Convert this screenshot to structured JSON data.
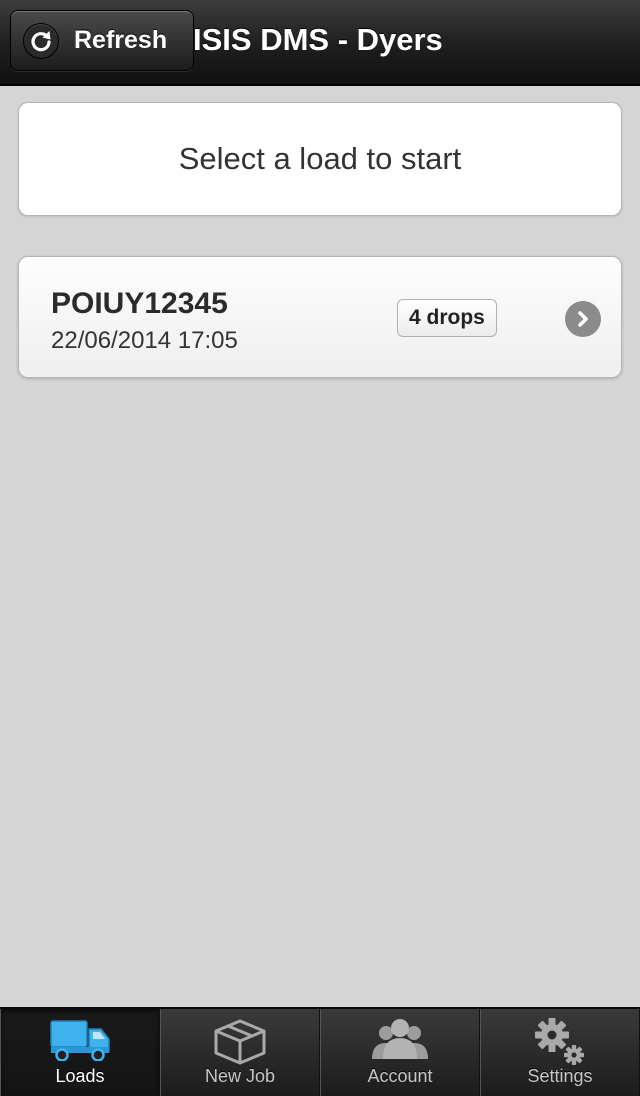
{
  "header": {
    "refresh_label": "Refresh",
    "title": "ISIS DMS - Dyers"
  },
  "prompt": {
    "text": "Select a load to start"
  },
  "loads": [
    {
      "id": "POIUY12345",
      "datetime": "22/06/2014 17:05",
      "drops": "4 drops"
    }
  ],
  "tabs": [
    {
      "label": "Loads",
      "icon": "truck-icon",
      "active": true
    },
    {
      "label": "New Job",
      "icon": "box-icon",
      "active": false
    },
    {
      "label": "Account",
      "icon": "users-icon",
      "active": false
    },
    {
      "label": "Settings",
      "icon": "gears-icon",
      "active": false
    }
  ],
  "colors": {
    "accent": "#3fb2ee",
    "header_bg": "#1e1e1e",
    "page_bg": "#d5d5d5"
  }
}
